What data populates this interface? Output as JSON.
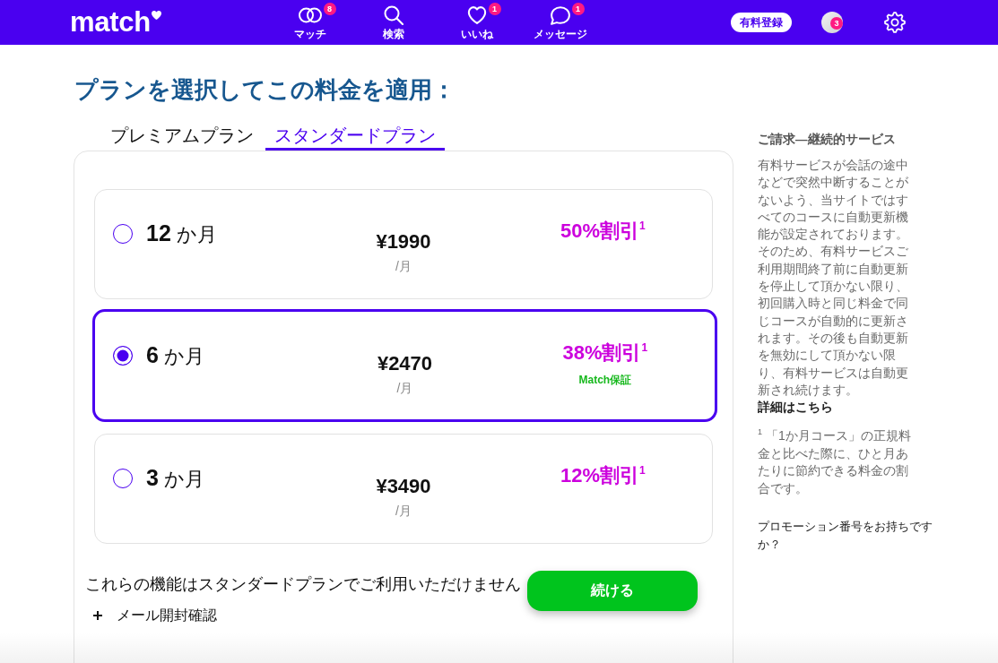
{
  "header": {
    "logo": "match",
    "nav": [
      {
        "kind": "rings",
        "label": "マッチ",
        "badge": "8"
      },
      {
        "kind": "search",
        "label": "検索"
      },
      {
        "kind": "heart",
        "label": "いいね",
        "badge": "1"
      },
      {
        "kind": "chat",
        "label": "メッセージ",
        "badge": "1"
      }
    ],
    "upgrade_button": "有料登録",
    "profile_badge": "3"
  },
  "heading": "プランを選択してこの料金を適用：",
  "tabs": [
    {
      "label": "プレミアムプラン",
      "selected": false
    },
    {
      "label": "スタンダードプラン",
      "selected": true
    }
  ],
  "plans": [
    {
      "term": "**12** か月",
      "price": "¥1990",
      "per": "/月",
      "discount": "50%割引$^{1}$",
      "selected": false
    },
    {
      "term": "**6** か月",
      "price": "¥2470",
      "per": "/月",
      "discount": "38%割引$^{1}$",
      "guarantee": "Match保証",
      "selected": true
    },
    {
      "term": "**3** か月",
      "price": "¥3490",
      "per": "/月",
      "discount": "12%割引$^{1}$",
      "selected": false
    }
  ],
  "unavailable_note": "これらの機能はスタンダードプランでご利用いただけません",
  "features": [
    "メール開封確認"
  ],
  "continue_button": "続ける",
  "sidebar": {
    "title": "ご請求―継続的サービス",
    "body": "有料サービスが会話の途中などで突然中断することがないよう、当サイトではすべてのコースに自動更新機能が設定されております。そのため、有料サービスご利用期間終了前に自動更新を停止して頂かない限り、初回購入時と同じ料金で同じコースが自動的に更新されます。その後も自動更新を無効にして頂かない限り、有料サービスは自動更新され続けます。",
    "details_link": "詳細はこちら",
    "footnote": "$^{1}$ 「1か月コース」の正規料金と比べた際に、ひと月あたりに節約できる料金の割合です。",
    "promo_link": "プロモーション番号をお持ちですか？"
  }
}
